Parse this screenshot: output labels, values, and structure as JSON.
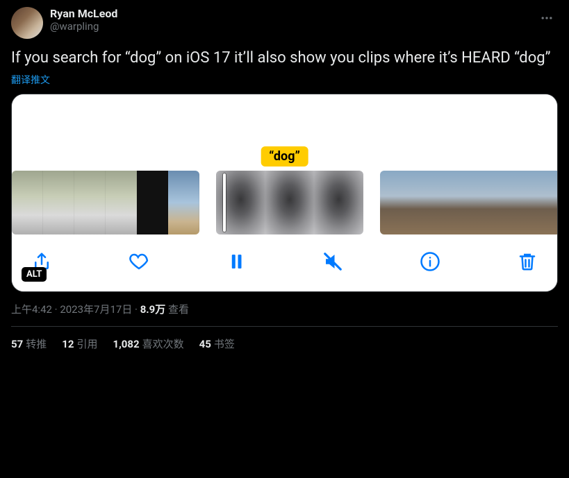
{
  "author": {
    "display_name": "Ryan McLeod",
    "handle": "@warpling"
  },
  "tweet_text": "If you search for “dog” on iOS 17 it’ll also show you clips where it’s HEARD “dog”",
  "translate_label": "翻译推文",
  "media": {
    "highlight_label": "“dog”",
    "alt_badge": "ALT",
    "toolbar_icons": {
      "share": "share-icon",
      "like": "heart-icon",
      "pause": "pause-icon",
      "mute": "mute-icon",
      "info": "info-icon",
      "delete": "trash-icon"
    }
  },
  "meta": {
    "time": "上午4:42",
    "sep1": " · ",
    "date": "2023年7月17日",
    "sep2": " · ",
    "views_count": "8.9万",
    "views_label": " 查看"
  },
  "stats": {
    "reposts": {
      "count": "57",
      "label": "转推"
    },
    "quotes": {
      "count": "12",
      "label": "引用"
    },
    "likes": {
      "count": "1,082",
      "label": "喜欢次数"
    },
    "bookmarks": {
      "count": "45",
      "label": "书签"
    }
  }
}
